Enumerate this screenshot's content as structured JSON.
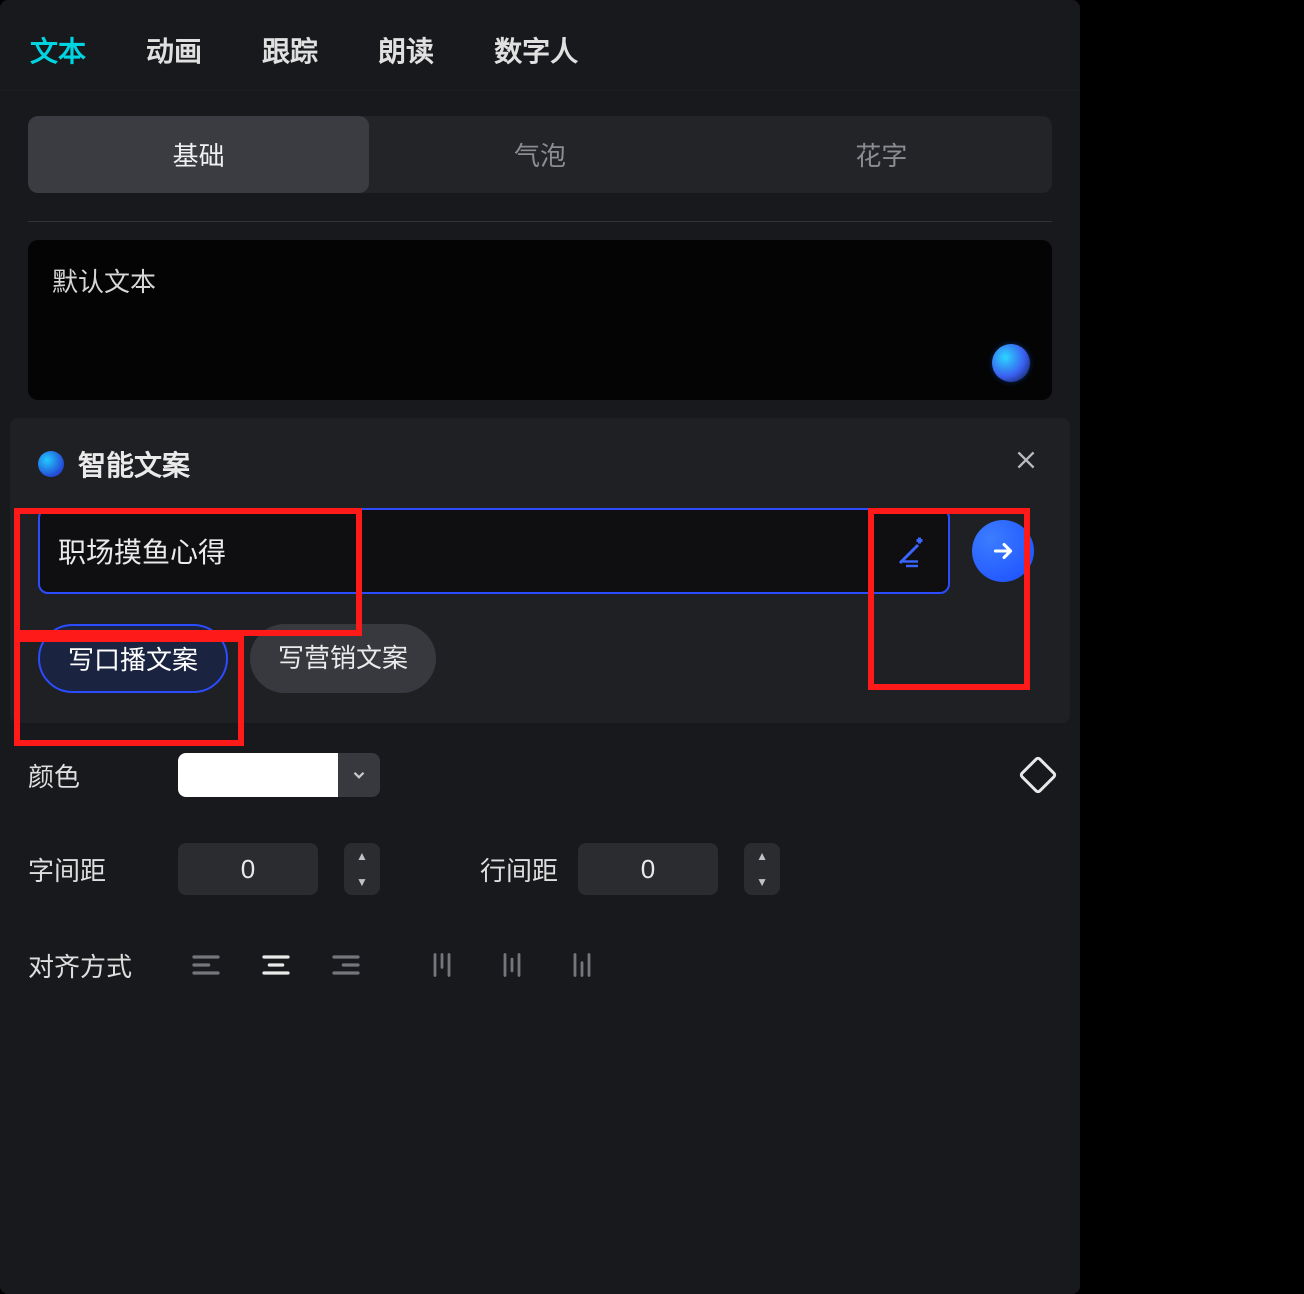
{
  "top_tabs": {
    "text": "文本",
    "animation": "动画",
    "track": "跟踪",
    "read": "朗读",
    "digital_human": "数字人"
  },
  "sub_tabs": {
    "basic": "基础",
    "bubble": "气泡",
    "fancy": "花字"
  },
  "text_area": {
    "placeholder": "默认文本"
  },
  "ai": {
    "title": "智能文案",
    "input_value": "职场摸鱼心得",
    "chip_voiceover": "写口播文案",
    "chip_marketing": "写营销文案"
  },
  "settings": {
    "color_label": "颜色",
    "color_value": "#FFFFFF",
    "letter_spacing_label": "字间距",
    "letter_spacing_value": "0",
    "line_spacing_label": "行间距",
    "line_spacing_value": "0",
    "align_label": "对齐方式"
  }
}
